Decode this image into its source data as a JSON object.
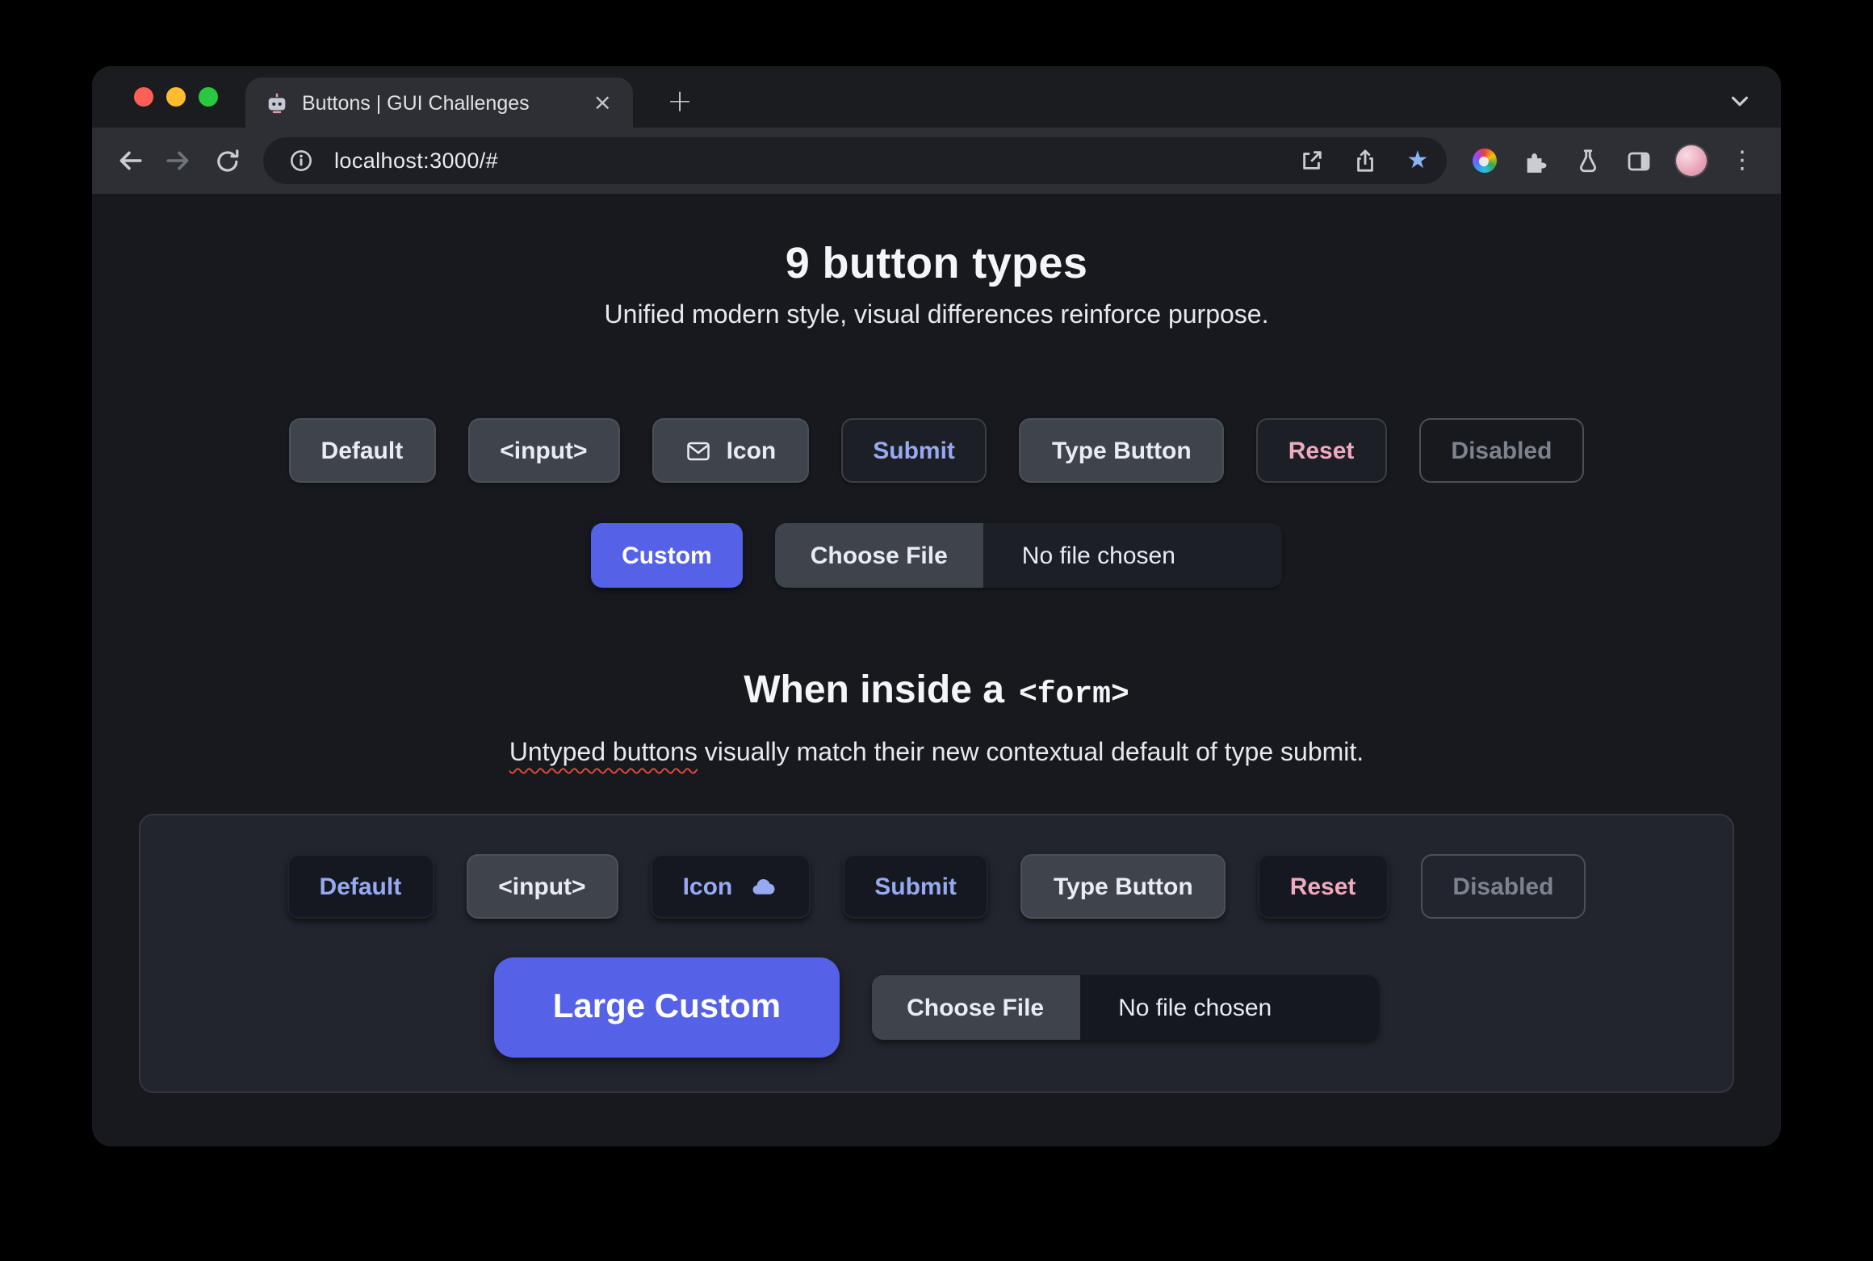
{
  "browser": {
    "tab": {
      "title": "Buttons | GUI Challenges",
      "close_glyph": "×"
    },
    "new_tab_glyph": "+",
    "url": "localhost:3000/#",
    "menu_glyph": "⋮",
    "bookmark_star_glyph": "★"
  },
  "page": {
    "hero": {
      "title": "9 button types",
      "subtitle": "Unified modern style, visual differences reinforce purpose."
    },
    "buttons": {
      "default": "Default",
      "input": "<input>",
      "icon": "Icon",
      "submit": "Submit",
      "type_button": "Type Button",
      "reset": "Reset",
      "disabled": "Disabled",
      "custom": "Custom",
      "large_custom": "Large Custom",
      "choose_file": "Choose File",
      "no_file": "No file chosen"
    },
    "form_section": {
      "title_text": "When inside a",
      "title_code": "<form>",
      "subtitle_misspelled": "Untyped buttons",
      "subtitle_rest": " visually match their new contextual default of type submit."
    },
    "colors": {
      "accent_indigo": "#5562e8",
      "blue_text": "#97aaf1",
      "pink_text": "#f0a9bd",
      "page_bg": "#17191e",
      "panel_bg": "#22252d",
      "gray_button": "#3e434c"
    }
  }
}
